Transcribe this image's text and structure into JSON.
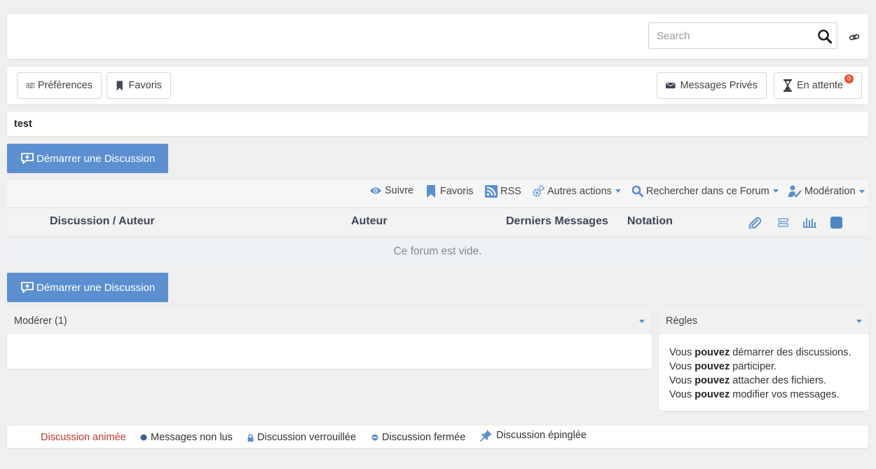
{
  "search": {
    "placeholder": "Search"
  },
  "toolbar": {
    "preferences_label": "Préférences",
    "favorites_label": "Favoris",
    "private_messages_label": "Messages Privés",
    "pending_label": "En attente",
    "pending_count": "0"
  },
  "forum": {
    "title": "test",
    "start_discussion_label": "Démarrer une Discussion",
    "actions": {
      "follow": "Suivre",
      "favorites": "Favoris",
      "rss": "RSS",
      "other_actions": "Autres actions",
      "search_forum": "Rechercher dans ce Forum",
      "moderation": "Modération"
    },
    "columns": {
      "discussion_author": "Discussion / Auteur",
      "author": "Auteur",
      "last_messages": "Derniers Messages",
      "rating": "Notation"
    },
    "empty_message": "Ce forum est vide."
  },
  "widgets": {
    "moderate_title": "Modérer (1)",
    "rules_title": "Règles",
    "rules": [
      {
        "pre": "Vous ",
        "strong": "pouvez",
        "post": " démarrer des discussions."
      },
      {
        "pre": "Vous ",
        "strong": "pouvez",
        "post": " participer."
      },
      {
        "pre": "Vous ",
        "strong": "pouvez",
        "post": " attacher des fichiers."
      },
      {
        "pre": "Vous ",
        "strong": "pouvez",
        "post": " modifier vos messages."
      }
    ]
  },
  "legend": {
    "hot": "Discussion animée",
    "unread": "Messages non lus",
    "locked": "Discussion verrouillée",
    "closed": "Discussion fermée",
    "pinned": "Discussion épinglée"
  },
  "colors": {
    "accent": "#5b8fd0",
    "hot": "#c0392b",
    "badge": "#e8542f",
    "unread_dot": "#3e5f96"
  }
}
